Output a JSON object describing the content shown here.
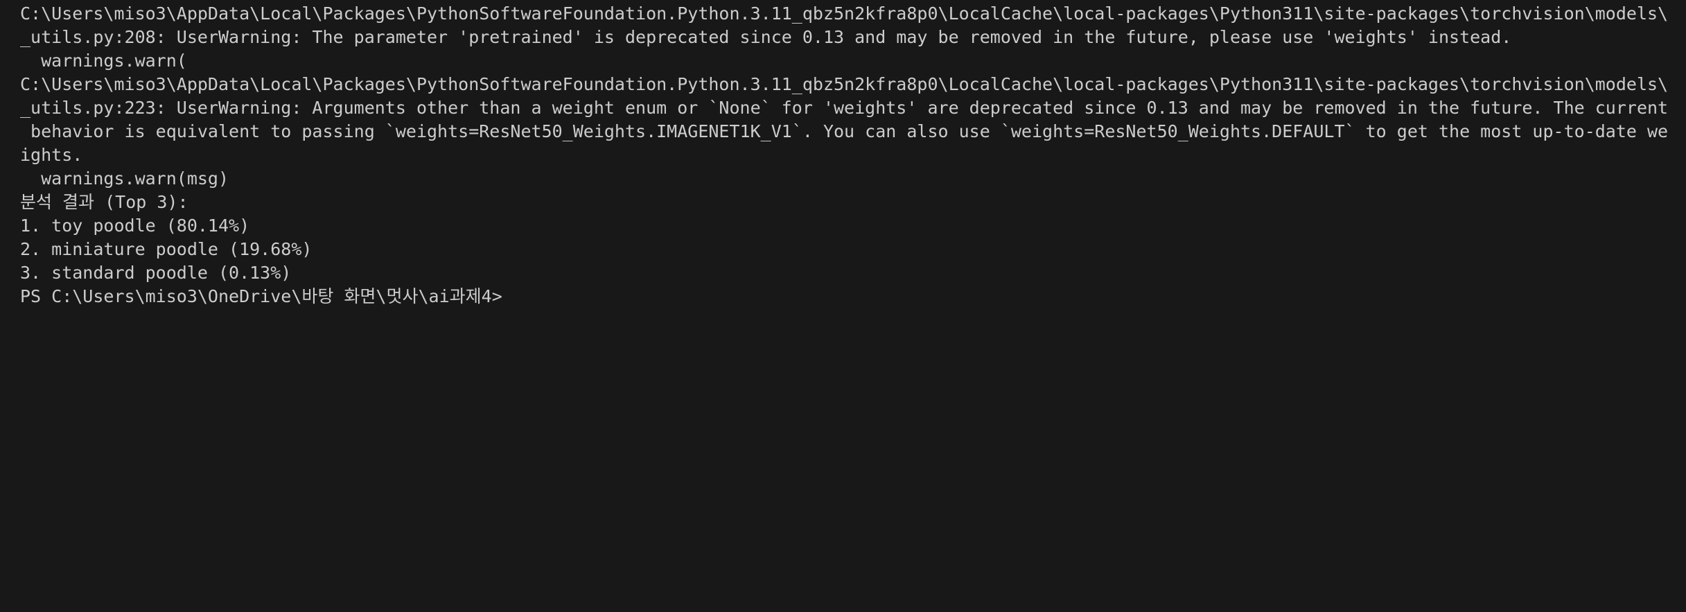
{
  "terminal": {
    "lines": [
      "C:\\Users\\miso3\\AppData\\Local\\Packages\\PythonSoftwareFoundation.Python.3.11_qbz5n2kfra8p0\\LocalCache\\local-packages\\Python311\\site-packages\\torchvision\\models\\",
      "_utils.py:208: UserWarning: The parameter 'pretrained' is deprecated since 0.13 and may be removed in the future, please use 'weights' instead.",
      "  warnings.warn(",
      "C:\\Users\\miso3\\AppData\\Local\\Packages\\PythonSoftwareFoundation.Python.3.11_qbz5n2kfra8p0\\LocalCache\\local-packages\\Python311\\site-packages\\torchvision\\models\\",
      "_utils.py:223: UserWarning: Arguments other than a weight enum or `None` for 'weights' are deprecated since 0.13 and may be removed in the future. The current",
      " behavior is equivalent to passing `weights=ResNet50_Weights.IMAGENET1K_V1`. You can also use `weights=ResNet50_Weights.DEFAULT` to get the most up-to-date we",
      "ights.",
      "  warnings.warn(msg)",
      "분석 결과 (Top 3):",
      "1. toy poodle (80.14%)",
      "2. miniature poodle (19.68%)",
      "3. standard poodle (0.13%)"
    ],
    "prompt": "PS C:\\Users\\miso3\\OneDrive\\바탕 화면\\멋사\\ai과제4>",
    "background": "#181818",
    "foreground": "#cccccc"
  }
}
